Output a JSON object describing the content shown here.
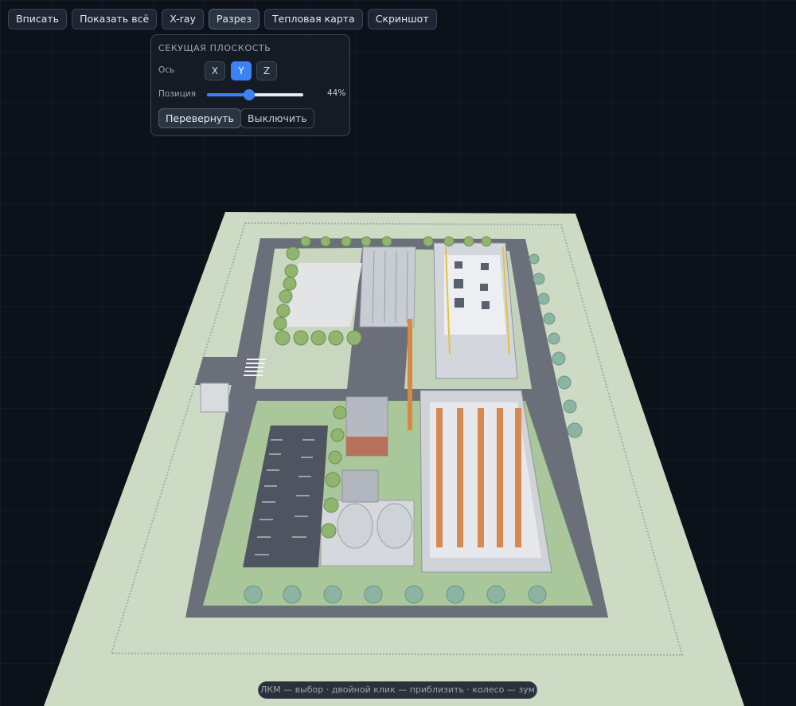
{
  "toolbar": {
    "buttons": [
      {
        "label": "Вписать"
      },
      {
        "label": "Показать всё"
      },
      {
        "label": "X-ray"
      },
      {
        "label": "Разрез",
        "active": true
      },
      {
        "label": "Тепловая карта"
      },
      {
        "label": "Скриншот"
      }
    ]
  },
  "section_panel": {
    "title": "СЕКУЩАЯ ПЛОСКОСТЬ",
    "axis_label": "Ось",
    "axes": [
      "X",
      "Y",
      "Z"
    ],
    "selected_axis": "Y",
    "position_label": "Позиция",
    "position_value": 0.44,
    "position_text": "44%",
    "flip_label": "Перевернуть",
    "off_label": "Выключить"
  },
  "hint": "ЛКМ — выбор · двойной клик — приблизить · колесо — зум",
  "colors": {
    "background": "#0c111a",
    "accent": "#3b82f6",
    "ground": "#cddbc4",
    "lawn": "#a9c79a",
    "road": "#6a6f7a",
    "building": "#c8ccd3",
    "tree": "#8fb56e",
    "rack": "#d8894f"
  }
}
